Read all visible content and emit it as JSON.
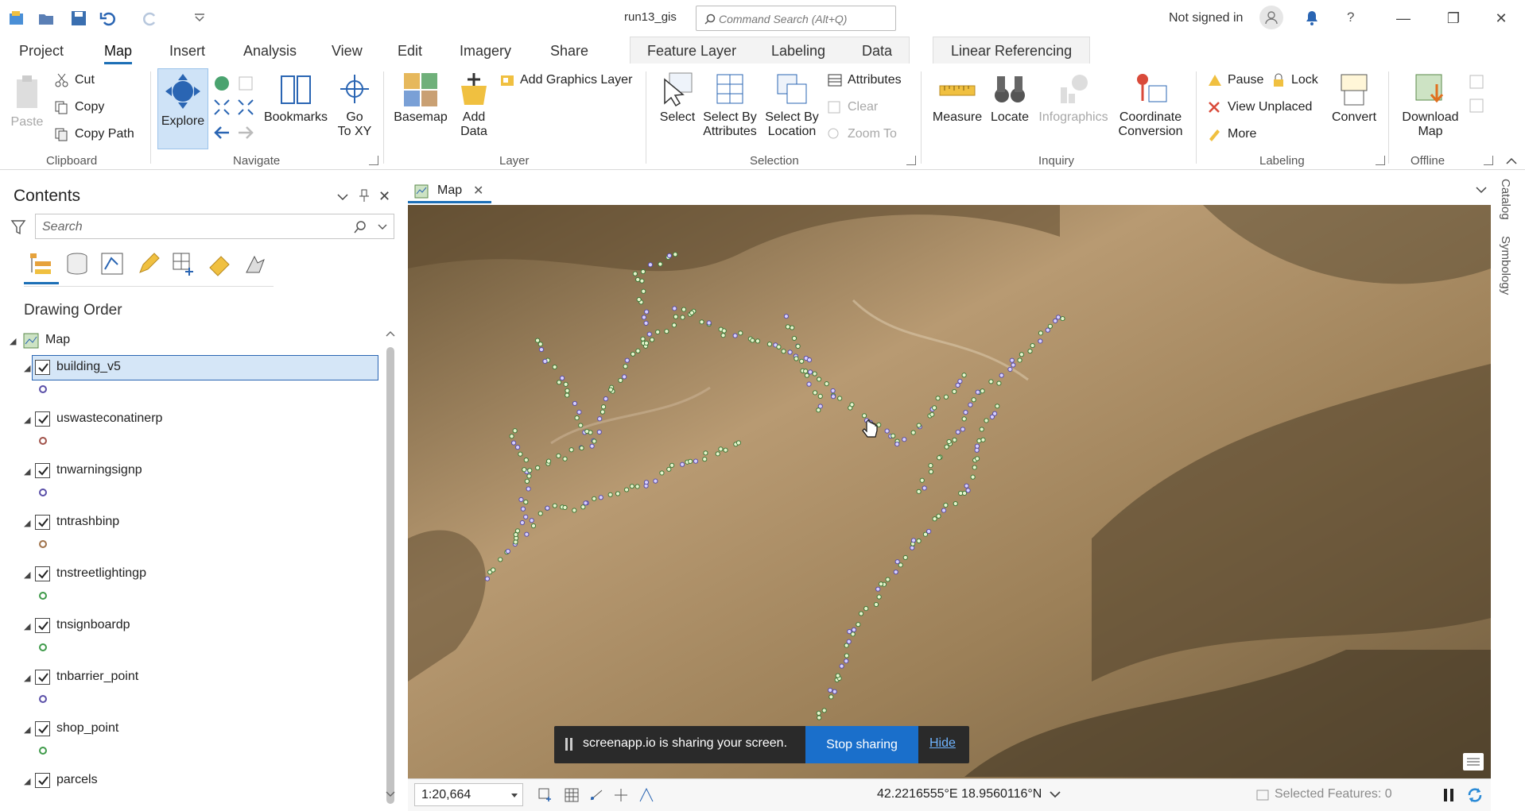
{
  "titlebar": {
    "app_title": "run13_gis",
    "command_search_placeholder": "Command Search (Alt+Q)",
    "signin_status": "Not signed in"
  },
  "tabs": {
    "main": [
      "Project",
      "Map",
      "Insert",
      "Analysis",
      "View",
      "Edit",
      "Imagery",
      "Share"
    ],
    "active": "Map",
    "contextual": [
      "Feature Layer",
      "Labeling",
      "Data"
    ],
    "extra": "Linear Referencing"
  },
  "ribbon": {
    "clipboard": {
      "paste": "Paste",
      "cut": "Cut",
      "copy": "Copy",
      "copy_path": "Copy Path",
      "label": "Clipboard"
    },
    "navigate": {
      "explore": "Explore",
      "bookmarks": "Bookmarks",
      "go_to_xy_line1": "Go",
      "go_to_xy_line2": "To XY",
      "label": "Navigate"
    },
    "layer": {
      "basemap": "Basemap",
      "add_data_line1": "Add",
      "add_data_line2": "Data",
      "add_graphics_layer": "Add Graphics Layer",
      "label": "Layer"
    },
    "selection": {
      "select": "Select",
      "select_by_attributes_line1": "Select By",
      "select_by_attributes_line2": "Attributes",
      "select_by_location_line1": "Select By",
      "select_by_location_line2": "Location",
      "attributes": "Attributes",
      "clear": "Clear",
      "zoom_to": "Zoom To",
      "label": "Selection"
    },
    "inquiry": {
      "measure": "Measure",
      "locate": "Locate",
      "infographics": "Infographics",
      "coord_conv_line1": "Coordinate",
      "coord_conv_line2": "Conversion",
      "label": "Inquiry"
    },
    "labeling": {
      "pause": "Pause",
      "lock": "Lock",
      "view_unplaced": "View Unplaced",
      "more": "More",
      "convert": "Convert",
      "label": "Labeling"
    },
    "offline": {
      "download_line1": "Download",
      "download_line2": "Map",
      "label": "Offline"
    }
  },
  "contents": {
    "title": "Contents",
    "search_placeholder": "Search",
    "drawing_order": "Drawing Order",
    "map_name": "Map",
    "layers": [
      {
        "name": "building_v5",
        "checked": true,
        "selected": true,
        "symbol_color": "#5a4fa8"
      },
      {
        "name": "uswasteconatinerp",
        "checked": true,
        "symbol_color": "#a0524a"
      },
      {
        "name": "tnwarningsignp",
        "checked": true,
        "symbol_color": "#5a4fa8"
      },
      {
        "name": "tntrashbinp",
        "checked": true,
        "symbol_color": "#a0724a"
      },
      {
        "name": "tnstreetlightingp",
        "checked": true,
        "symbol_color": "#3f9a4a"
      },
      {
        "name": "tnsignboardp",
        "checked": true,
        "symbol_color": "#3f9a4a"
      },
      {
        "name": "tnbarrier_point",
        "checked": true,
        "symbol_color": "#5a4fa8"
      },
      {
        "name": "shop_point",
        "checked": true,
        "symbol_color": "#3f9a4a"
      },
      {
        "name": "parcels",
        "checked": true
      }
    ]
  },
  "map": {
    "tab_label": "Map",
    "scale": "1:20,664",
    "coordinates": "42.2216555°E 18.9560116°N",
    "selected_features": "Selected Features: 0"
  },
  "dock": {
    "catalog": "Catalog",
    "symbology": "Symbology"
  },
  "share_toast": {
    "message": "screenapp.io is sharing your screen.",
    "stop_label": "Stop sharing",
    "hide_label": "Hide"
  },
  "colors": {
    "accent": "#1c6fb6",
    "selected_row": "#d5e6f7",
    "stop_button": "#1a6fcb"
  }
}
